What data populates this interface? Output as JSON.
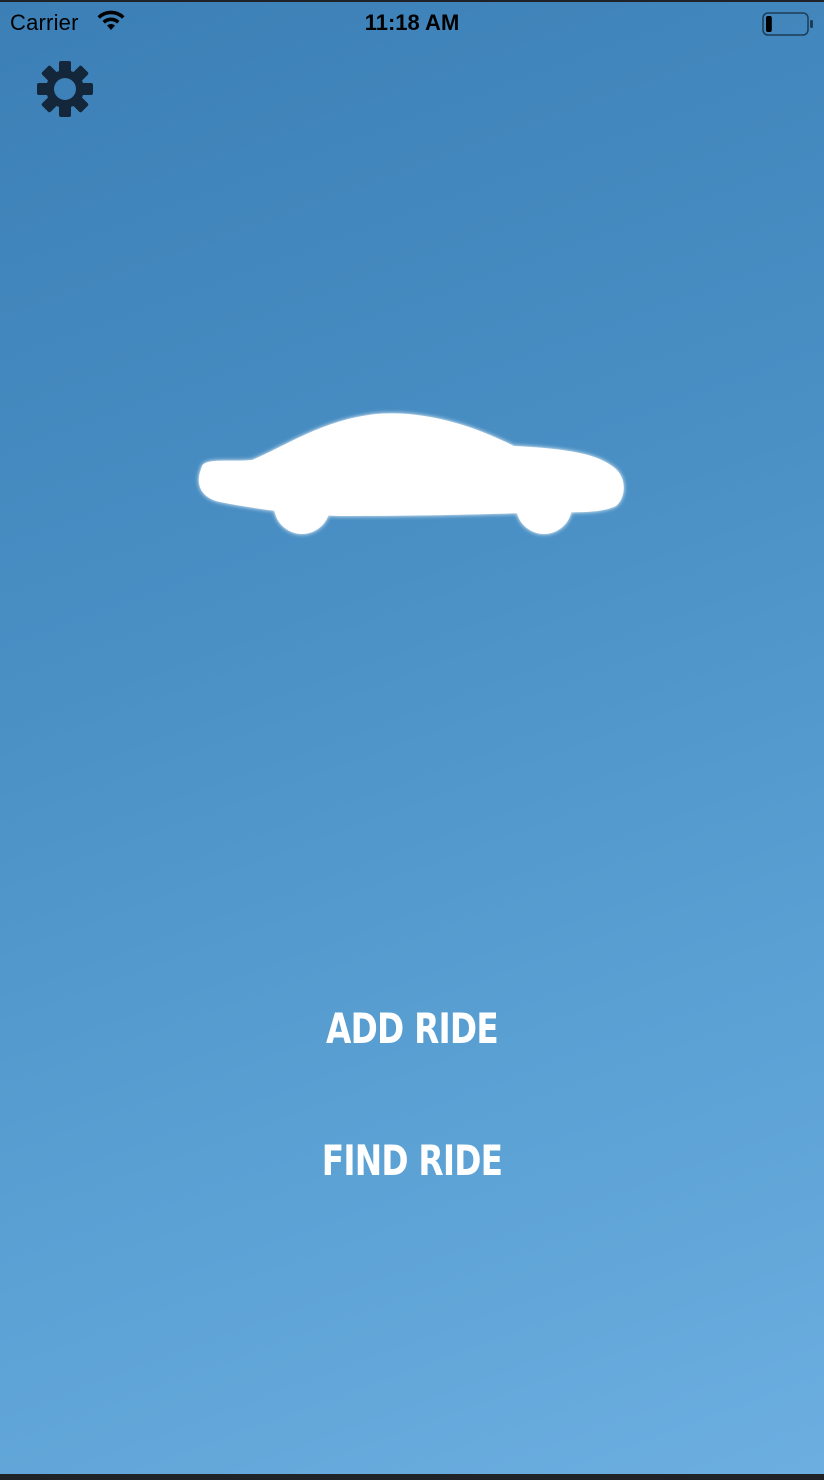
{
  "status_bar": {
    "carrier": "Carrier",
    "time": "11:18 AM",
    "wifi_icon": "wifi-icon",
    "battery_icon": "battery-icon",
    "battery_level_fraction": 0.15
  },
  "header": {
    "settings_icon": "gear-icon"
  },
  "hero": {
    "image": "car-silhouette"
  },
  "actions": {
    "add_ride_label": "ADD RIDE",
    "find_ride_label": "FIND RIDE"
  },
  "colors": {
    "gradient_top": "#3b7fb6",
    "gradient_bottom": "#6caee0",
    "icon_dark": "#13263a",
    "text_light": "#ffffff"
  }
}
